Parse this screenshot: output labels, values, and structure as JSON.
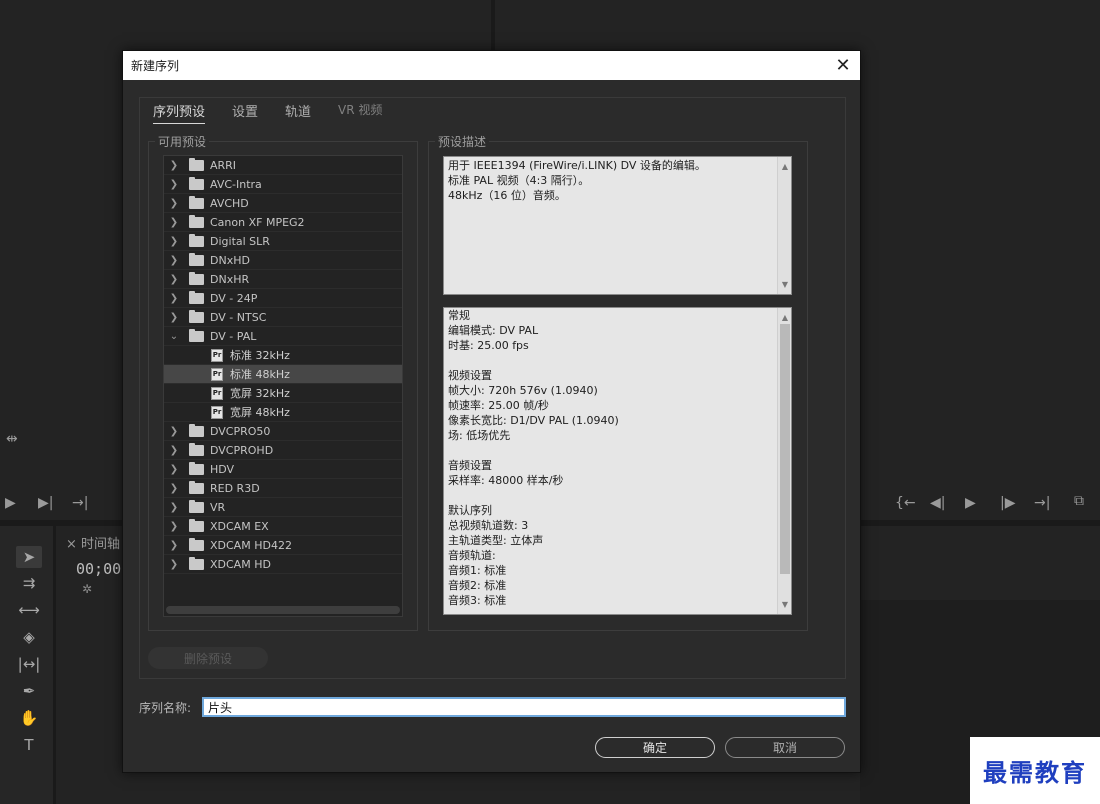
{
  "dialog": {
    "title": "新建序列",
    "tabs": [
      {
        "label": "序列预设"
      },
      {
        "label": "设置"
      },
      {
        "label": "轨道"
      },
      {
        "label": "VR 视频"
      }
    ],
    "available_presets_label": "可用预设",
    "preset_description_label": "预设描述",
    "tree": [
      {
        "label": "ARRI"
      },
      {
        "label": "AVC-Intra"
      },
      {
        "label": "AVCHD"
      },
      {
        "label": "Canon XF MPEG2"
      },
      {
        "label": "Digital SLR"
      },
      {
        "label": "DNxHD"
      },
      {
        "label": "DNxHR"
      },
      {
        "label": "DV - 24P"
      },
      {
        "label": "DV - NTSC"
      },
      {
        "label": "DV - PAL",
        "children": [
          {
            "label": "标准 32kHz"
          },
          {
            "label": "标准 48kHz"
          },
          {
            "label": "宽屏 32kHz"
          },
          {
            "label": "宽屏 48kHz"
          }
        ]
      },
      {
        "label": "DVCPRO50"
      },
      {
        "label": "DVCPROHD"
      },
      {
        "label": "HDV"
      },
      {
        "label": "RED R3D"
      },
      {
        "label": "VR"
      },
      {
        "label": "XDCAM EX"
      },
      {
        "label": "XDCAM HD422"
      },
      {
        "label": "XDCAM HD"
      }
    ],
    "description_lines": [
      "用于 IEEE1394 (FireWire/i.LINK) DV 设备的编辑。",
      "标准 PAL 视频（4:3 隔行）。",
      "48kHz（16 位）音频。"
    ],
    "details_lines": [
      "常规",
      " 编辑模式: DV PAL",
      " 时基: 25.00 fps",
      "",
      "视频设置",
      " 帧大小: 720h 576v (1.0940)",
      " 帧速率: 25.00  帧/秒",
      " 像素长宽比: D1/DV PAL (1.0940)",
      " 场: 低场优先",
      "",
      "音频设置",
      " 采样率: 48000 样本/秒",
      "",
      "默认序列",
      " 总视频轨道数: 3",
      " 主轨道类型: 立体声",
      " 音频轨道:",
      " 音频1: 标准",
      " 音频2: 标准",
      " 音频3: 标准"
    ],
    "delete_preset_label": "删除预设",
    "sequence_name_label": "序列名称:",
    "sequence_name_value": "片头",
    "ok_label": "确定",
    "cancel_label": "取消"
  },
  "background": {
    "timeline_tab": "时间轴",
    "timecode": "00;00;"
  },
  "watermark": "最需教育"
}
